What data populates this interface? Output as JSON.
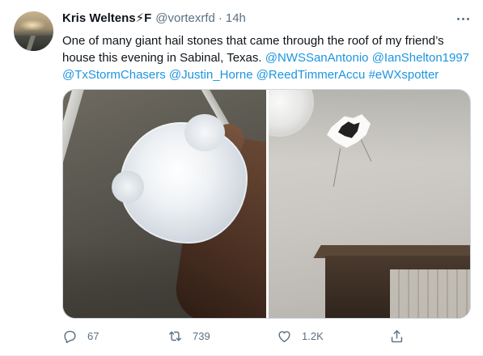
{
  "tweet": {
    "author": {
      "name": "Kris Weltens⚡F",
      "handle": "@vortexrfd",
      "separator": "·",
      "time": "14h"
    },
    "text": {
      "lines": [
        "One of many giant hail stones that came through the roof of my friend’s",
        "house this evening in Sabinal, Texas. "
      ],
      "mentions_line2": [
        "@NWSSanAntonio",
        "@IanShelton1997"
      ],
      "mentions_line3": [
        "@TxStormChasers",
        "@Justin_Horne",
        "@ReedTimmerAccu",
        "#eWXspotter"
      ]
    },
    "media": [
      {
        "icon": "hailstone-in-hand-photo"
      },
      {
        "icon": "ceiling-hole-photo"
      }
    ],
    "actions": {
      "reply": {
        "icon": "reply-icon",
        "count": "67"
      },
      "retweet": {
        "icon": "retweet-icon",
        "count": "739"
      },
      "like": {
        "icon": "like-icon",
        "count": "1.2K"
      },
      "share": {
        "icon": "share-icon"
      }
    }
  },
  "colors": {
    "text": "#0f1419",
    "secondary": "#5b7083",
    "link": "#1b95e0",
    "border": "#ebeef0"
  }
}
